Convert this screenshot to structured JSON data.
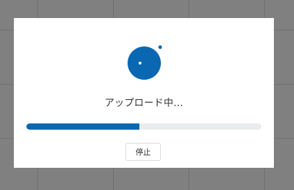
{
  "upload": {
    "status_text": "アップロード中...",
    "progress": 0.48,
    "stop_label": "停止"
  },
  "icons": {
    "spinner": "uploading-blob-icon"
  },
  "colors": {
    "accent": "#0a67b1",
    "track": "#e9ecef",
    "backdrop": "#808080",
    "dialog": "#ffffff"
  }
}
